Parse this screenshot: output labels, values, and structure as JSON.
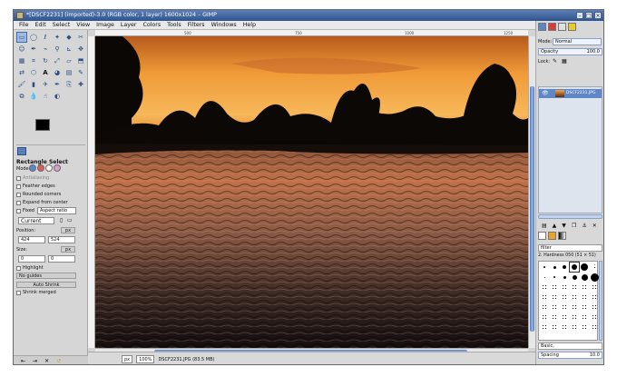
{
  "window": {
    "title": "*[DSCF2231] (imported)-3.0 (RGB color, 1 layer) 1600x1024 – GIMP",
    "controls": [
      "–",
      "□",
      "×"
    ]
  },
  "menu": [
    "File",
    "Edit",
    "Select",
    "View",
    "Image",
    "Layer",
    "Colors",
    "Tools",
    "Filters",
    "Windows",
    "Help"
  ],
  "toolbox": {
    "tool_icons": [
      "rect-select",
      "ellipse-select",
      "free-select",
      "fuzzy-select",
      "select-by-color",
      "scissors",
      "foreground-select",
      "paths",
      "color-picker",
      "zoom",
      "measure",
      "move",
      "align",
      "crop",
      "rotate",
      "scale",
      "shear",
      "perspective",
      "flip",
      "cage",
      "text",
      "bucket-fill",
      "blend",
      "pencil",
      "paintbrush",
      "eraser",
      "airbrush",
      "ink",
      "clone",
      "heal",
      "perspective-clone",
      "blur",
      "smudge",
      "dodge-burn"
    ],
    "options": {
      "title": "Rectangle Select",
      "mode_label": "Mode:",
      "antialiasing": "Antialiasing",
      "feather": "Feather edges",
      "rounded": "Rounded corners",
      "expand": "Expand from center",
      "fixed": "Fixed",
      "fixed_value": "Aspect ratio",
      "current": "Current",
      "position_label": "Position:",
      "position_unit": "px",
      "pos_x": "424",
      "pos_y": "524",
      "size_label": "Size:",
      "size_unit": "px",
      "size_w": "0",
      "size_h": "0",
      "highlight": "Highlight",
      "guides": "No guides",
      "autoshrink": "Auto Shrink",
      "shrink_merged": "Shrink merged"
    }
  },
  "status": {
    "unit": "px",
    "zoom": "100%",
    "filename": "DSCF2231.JPG (83.5 MB)"
  },
  "ruler": {
    "ticks": [
      "500",
      "750",
      "1000",
      "1250"
    ]
  },
  "layers_dock": {
    "mode_label": "Mode:",
    "mode": "Normal",
    "opacity_label": "Opacity",
    "opacity": "100.0",
    "lock_label": "Lock:",
    "layer_name": "DSCF2231.JPG"
  },
  "brushes_dock": {
    "filter": "filter",
    "selected": "2. Hardness 050 (51 × 51)",
    "preset": "Basic,",
    "spacing_label": "Spacing",
    "spacing": "10.0"
  }
}
